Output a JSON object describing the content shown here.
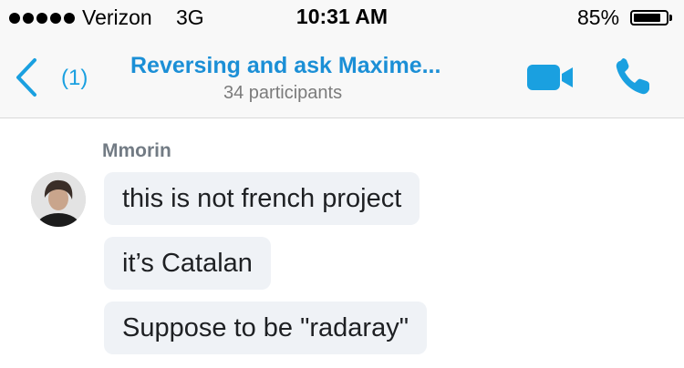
{
  "status_bar": {
    "carrier": "Verizon",
    "network": "3G",
    "time": "10:31 AM",
    "battery_percent": "85%",
    "battery_level": 0.85,
    "signal_bars": 5
  },
  "nav": {
    "back_icon": "chevron-left-icon",
    "back_count": "(1)",
    "title": "Reversing and ask Maxime...",
    "participants": "34 participants",
    "video_icon": "video-camera-icon",
    "call_icon": "phone-icon",
    "accent_color": "#1aa0e0"
  },
  "messages": {
    "sender": "Mmorin",
    "items": [
      "this is not french project",
      "it’s Catalan",
      "Suppose to be \"radaray\""
    ]
  }
}
